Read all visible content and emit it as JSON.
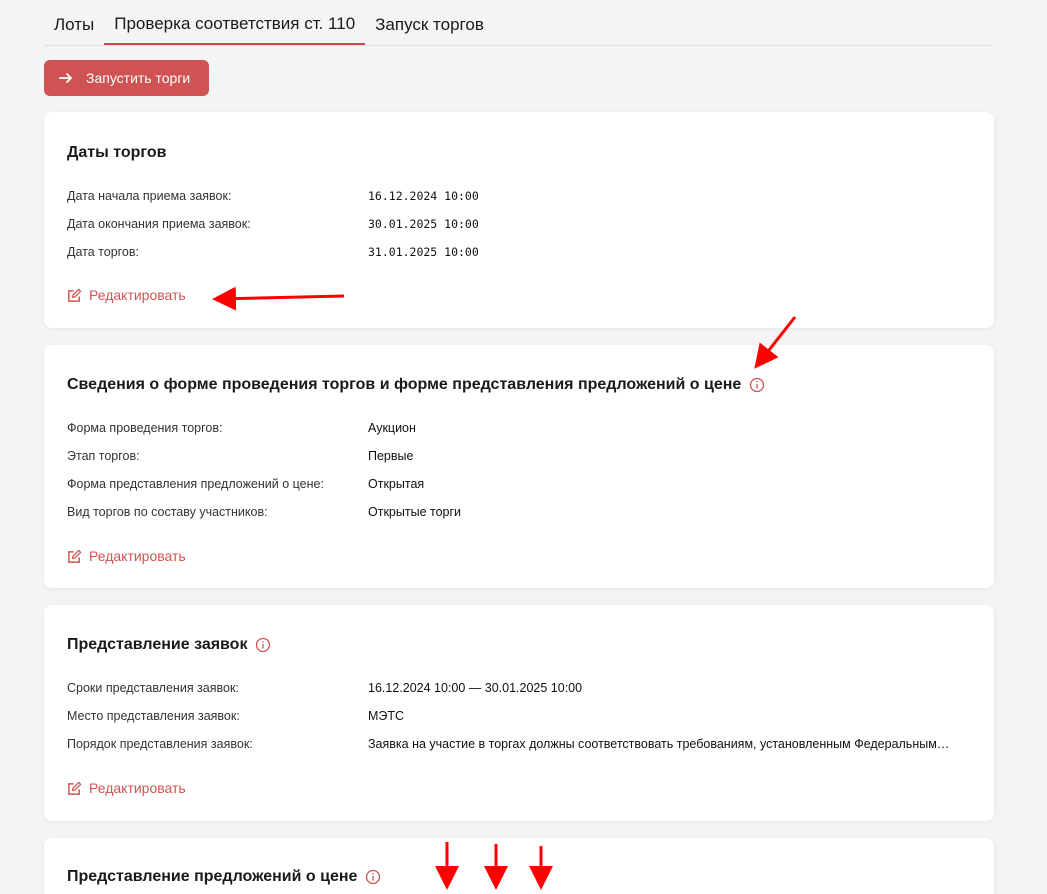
{
  "tabs": [
    {
      "label": "Лоты"
    },
    {
      "label": "Проверка соответствия ст. 110"
    },
    {
      "label": "Запуск торгов"
    }
  ],
  "launch_button": {
    "label": "Запустить торги"
  },
  "card1": {
    "title": "Даты торгов",
    "rows": [
      {
        "label": "Дата начала приема заявок:",
        "value": "16.12.2024 10:00"
      },
      {
        "label": "Дата окончания приема заявок:",
        "value": "30.01.2025 10:00"
      },
      {
        "label": "Дата торгов:",
        "value": "31.01.2025 10:00"
      }
    ],
    "edit_label": "Редактировать"
  },
  "card2": {
    "title": "Сведения о форме проведения торгов и форме представления предложений о цене",
    "rows": [
      {
        "label": "Форма проведения торгов:",
        "value": "Аукцион"
      },
      {
        "label": "Этап торгов:",
        "value": "Первые"
      },
      {
        "label": "Форма представления предложений о цене:",
        "value": "Открытая"
      },
      {
        "label": "Вид торгов по составу участников:",
        "value": "Открытые торги"
      }
    ],
    "edit_label": "Редактировать"
  },
  "card3": {
    "title": "Представление заявок",
    "rows": [
      {
        "label": "Сроки представления заявок:",
        "value": "16.12.2024 10:00 — 30.01.2025 10:00"
      },
      {
        "label": "Место представления заявок:",
        "value": "МЭТС"
      },
      {
        "label": "Порядок представления заявок:",
        "value": "Заявка на участие в торгах должны соответствовать требованиям, установленным Федеральным…"
      }
    ],
    "edit_label": "Редактировать"
  },
  "card4": {
    "title": "Представление предложений о цене"
  },
  "colors": {
    "accent": "#d05353",
    "annotation_arrow": "#ff0000"
  }
}
